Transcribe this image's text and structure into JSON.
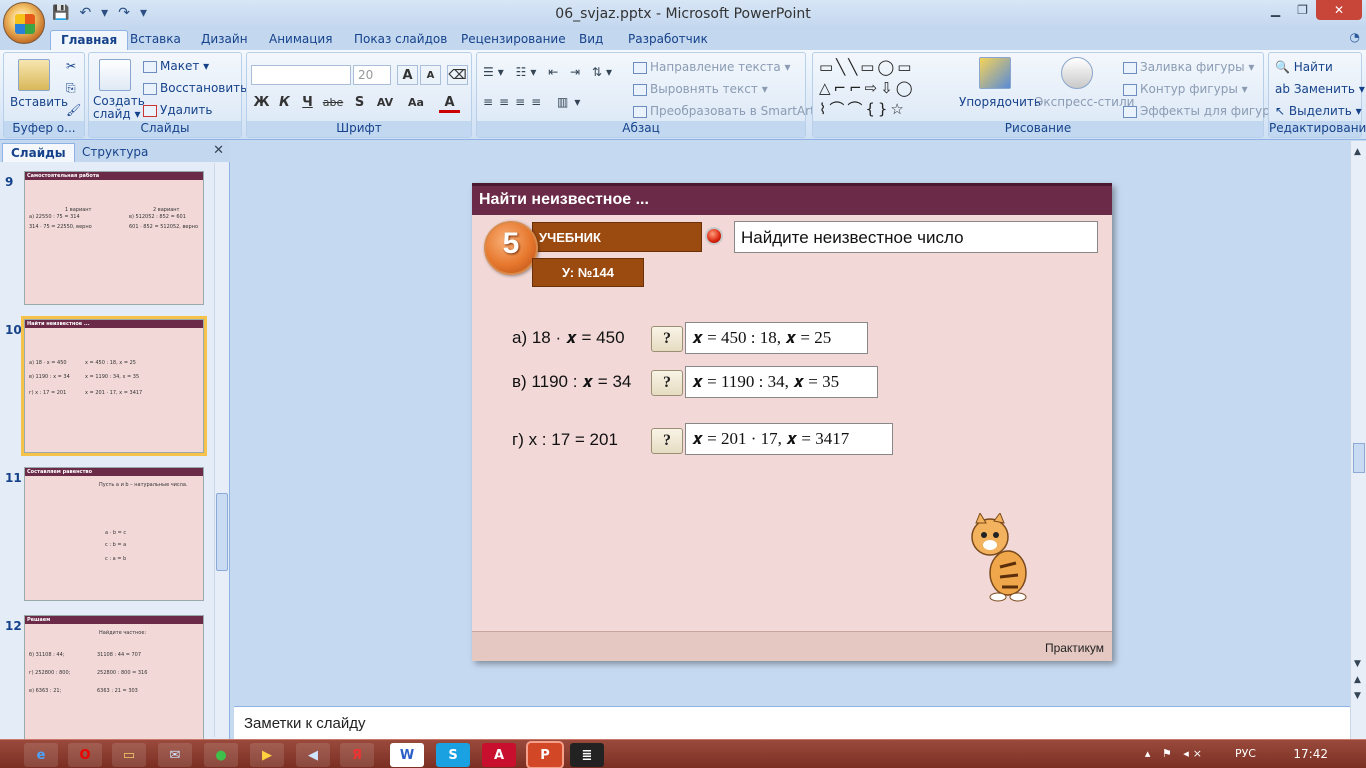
{
  "window": {
    "title": "06_svjaz.pptx - Microsoft PowerPoint",
    "qat": [
      "💾",
      "↶",
      "▾",
      "↷",
      "▾"
    ]
  },
  "ribbon_tabs": [
    "Главная",
    "Вставка",
    "Дизайн",
    "Анимация",
    "Показ слайдов",
    "Рецензирование",
    "Вид",
    "Разработчик"
  ],
  "ribbon": {
    "clipboard": {
      "paste": "Вставить",
      "label": "Буфер о..."
    },
    "slides": {
      "create": "Создать слайд ▾",
      "layout": "Макет ▾",
      "reset": "Восстановить",
      "delete": "Удалить",
      "label": "Слайды"
    },
    "font": {
      "size": "20",
      "label": "Шрифт",
      "buttons": [
        "Ж",
        "К",
        "Ч",
        "abe",
        "S",
        "AV",
        "Aa",
        "A"
      ]
    },
    "paragraph": {
      "text_dir": "Направление текста ▾",
      "align_text": "Выровнять текст ▾",
      "smartart": "Преобразовать в SmartArt ▾",
      "label": "Абзац"
    },
    "drawing": {
      "arrange": "Упорядочить",
      "styles": "Экспресс-стили",
      "fill": "Заливка фигуры ▾",
      "outline": "Контур фигуры ▾",
      "effects": "Эффекты для фигур ▾",
      "label": "Рисование",
      "shapes": "▭╲╲▭◯▭ △⌐⌐⇨⇩◯ ⌇⌒⌒{}☆"
    },
    "editing": {
      "find": "Найти",
      "replace": "Заменить ▾",
      "select": "Выделить ▾",
      "label": "Редактирование"
    }
  },
  "pane": {
    "tabs": [
      "Слайды",
      "Структура"
    ],
    "thumbnails": [
      {
        "num": "9",
        "title": "Самостоятельная работа",
        "lines": [
          "1 вариант",
          "2 вариант",
          "а) 22550 : 75 = 314",
          "в) 512052 : 852 = 601",
          "314 · 75 = 22550, верно",
          "601 · 852 = 512052, верно"
        ]
      },
      {
        "num": "10",
        "title": "Найти неизвестное ...",
        "lines": [
          "а) 18 · x = 450",
          "в) 1190 : x = 34",
          "г) x : 17 = 201",
          "x = 450 : 18, x = 25",
          "x = 1190 : 34, x = 35",
          "x = 201 · 17, x = 3417"
        ]
      },
      {
        "num": "11",
        "title": "Составляем равенство",
        "lines": [
          "Пусть a и b – натуральные числа.",
          "a · b = c",
          "c : b = a",
          "c : a = b"
        ]
      },
      {
        "num": "12",
        "title": "Решаем",
        "lines": [
          "Найдите частное:",
          "б) 31108 : 44;",
          "г) 252800 : 800;",
          "е) 6363 : 21;",
          "31108 : 44 = 707",
          "252800 : 800 = 316",
          "6363 : 21 = 303"
        ]
      }
    ]
  },
  "slide": {
    "title": "Найти неизвестное ...",
    "badge": "5",
    "book": "УЧЕБНИК",
    "task_ref": "У: №144",
    "task": "Найдите неизвестное  число",
    "question_mark": "?",
    "rows": [
      {
        "eq": "а) 18 · 𝒙 = 450",
        "ans": "𝒙 = 450 : 18,  𝒙 = 25"
      },
      {
        "eq": "в) 1190 : 𝒙 = 34",
        "ans": "𝒙 = 1190 : 34,  𝒙 = 35"
      },
      {
        "eq": "г) x : 17 = 201",
        "ans": "𝒙 = 201 · 17,  𝒙 = 3417"
      }
    ],
    "footer": "Практикум"
  },
  "notes": "Заметки к слайду",
  "taskbar": {
    "lang": "РУС",
    "clock": "17:42"
  },
  "colors": {
    "slide_header": "#6b2a48",
    "book_bar": "#9c4b10",
    "slide_bg": "#f2d9d8"
  }
}
